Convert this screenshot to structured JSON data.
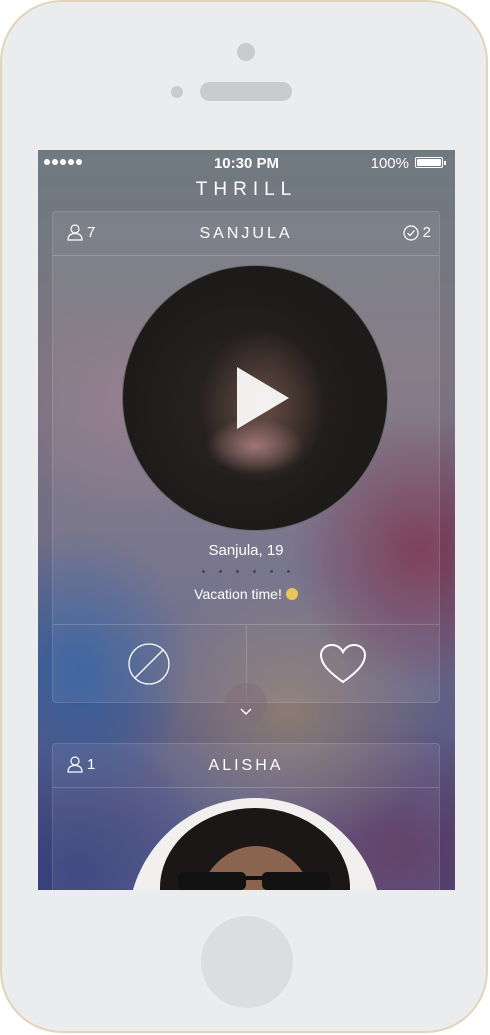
{
  "status_bar": {
    "time": "10:30 PM",
    "battery": "100%"
  },
  "app": {
    "title": "THRILL"
  },
  "cards": [
    {
      "name": "SANJULA",
      "friends_count": "7",
      "mutual_count": "2",
      "person_line": "Sanjula, 19",
      "caption": "Vacation time!",
      "page_dots": 6
    },
    {
      "name": "ALISHA",
      "friends_count": "1"
    }
  ],
  "icons": [
    "user-icon",
    "check-circle-icon",
    "play-icon",
    "pass-icon",
    "heart-icon",
    "chevron-down-icon",
    "smiley-emoji-icon"
  ],
  "colors": {
    "frame": "#e3d3bc",
    "phone_body": "#ebeced",
    "text": "#ffffff"
  }
}
